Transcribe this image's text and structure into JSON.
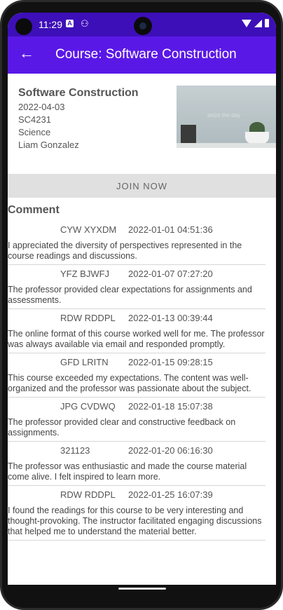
{
  "status": {
    "time": "11:29",
    "a_icon": "A"
  },
  "appbar": {
    "title": "Course: Software Construction",
    "back_icon": "arrow-back-icon"
  },
  "course": {
    "name": "Software Construction",
    "date": "2022-04-03",
    "code": "SC4231",
    "category": "Science",
    "instructor": "Liam Gonzalez",
    "image_text": "seize the day"
  },
  "join_label": "JOIN NOW",
  "comment_title": "Comment",
  "comments": [
    {
      "user": "CYW XYXDM",
      "date": "2022-01-01 04:51:36",
      "text": "I appreciated the diversity of perspectives represented in the course readings and discussions."
    },
    {
      "user": "YFZ BJWFJ",
      "date": "2022-01-07 07:27:20",
      "text": "The professor provided clear expectations for assignments and assessments."
    },
    {
      "user": "RDW RDDPL",
      "date": "2022-01-13 00:39:44",
      "text": "The online format of this course worked well for me. The professor was always available via email and responded promptly."
    },
    {
      "user": "GFD LRITN",
      "date": "2022-01-15 09:28:15",
      "text": "This course exceeded my expectations. The content was well-organized and the professor was passionate about the subject."
    },
    {
      "user": "JPG CVDWQ",
      "date": "2022-01-18 15:07:38",
      "text": "The professor provided clear and constructive feedback on assignments."
    },
    {
      "user": "321123",
      "date": "2022-01-20 06:16:30",
      "text": "The professor was enthusiastic and made the course material come alive. I felt inspired to learn more."
    },
    {
      "user": "RDW RDDPL",
      "date": "2022-01-25 16:07:39",
      "text": "I found the readings for this course to be very interesting and thought-provoking. The instructor facilitated engaging discussions that helped me to understand the material better."
    }
  ]
}
